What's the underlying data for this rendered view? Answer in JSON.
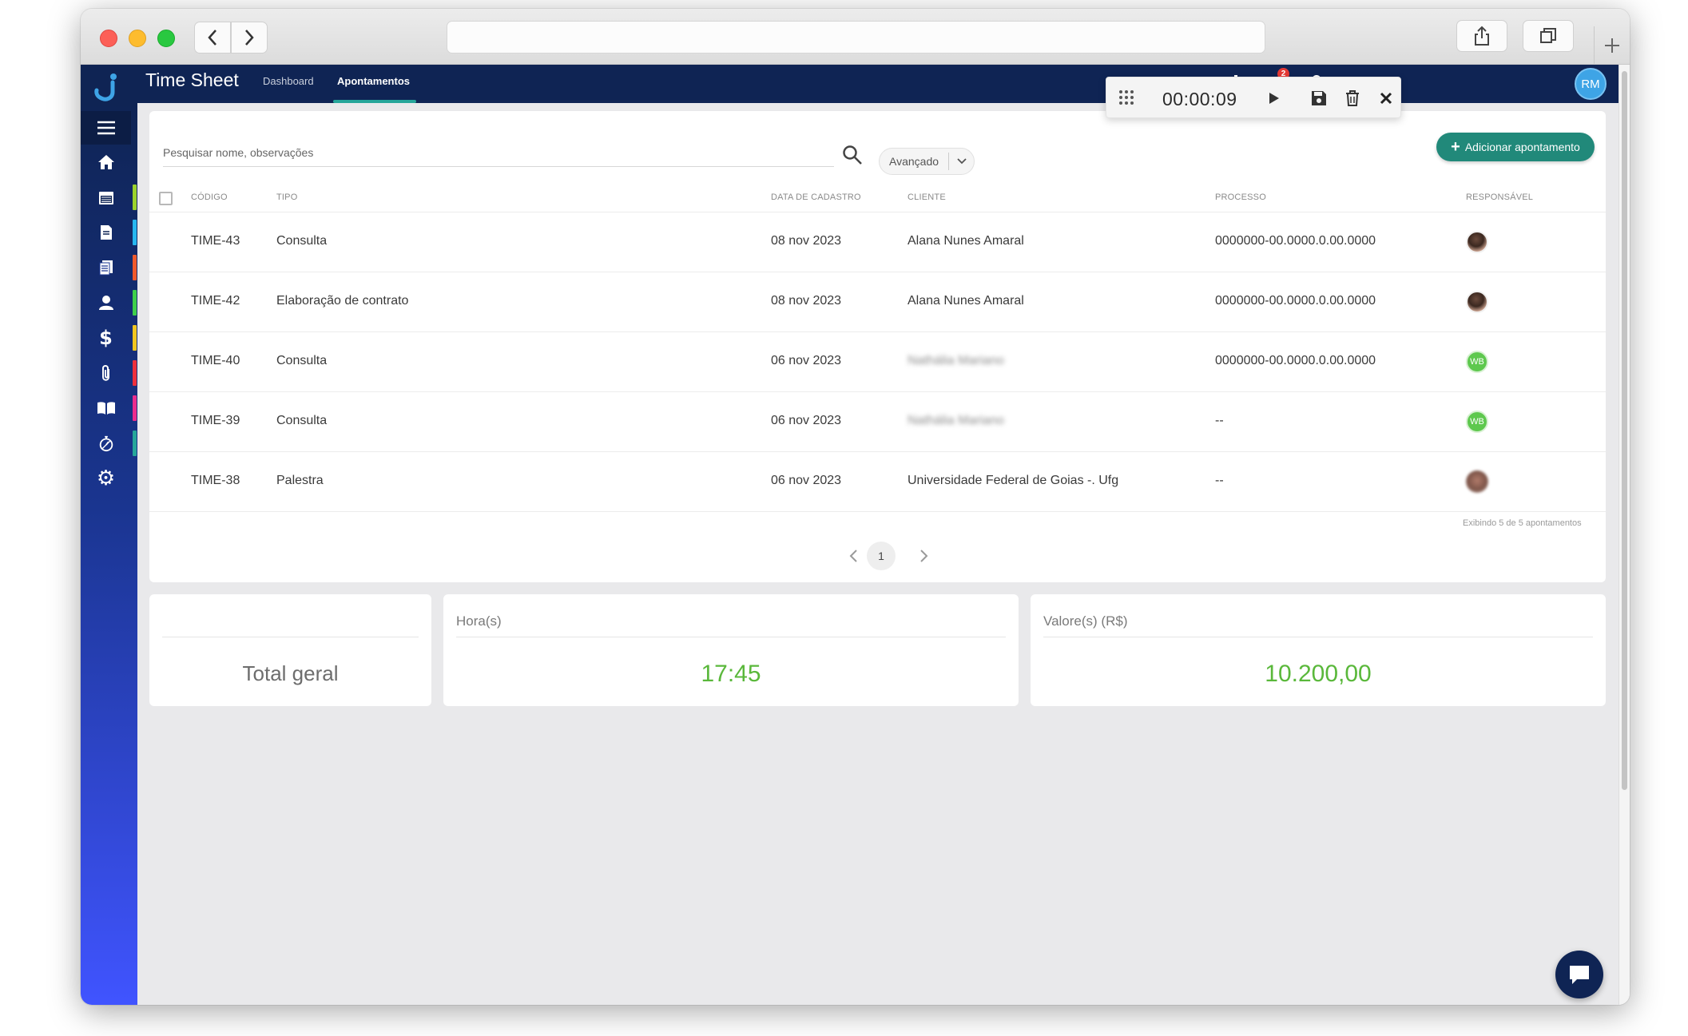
{
  "app": {
    "title": "Time Sheet",
    "nav": [
      {
        "label": "Dashboard"
      },
      {
        "label": "Apontamentos"
      }
    ],
    "notification_badge": "2",
    "user_initials": "RM"
  },
  "timer": {
    "time": "00:00:09"
  },
  "search": {
    "placeholder": "Pesquisar nome, observações",
    "advanced_label": "Avançado"
  },
  "actions": {
    "add_label": "Adicionar apontamento"
  },
  "table": {
    "columns": [
      "Código",
      "Tipo",
      "Data de cadastro",
      "Cliente",
      "Processo",
      "Responsável"
    ],
    "rows": [
      {
        "codigo": "TIME-43",
        "tipo": "Consulta",
        "data": "08 nov 2023",
        "cliente": "Alana Nunes Amaral",
        "processo": "0000000-00.0000.0.00.0000",
        "responsavel": "photo"
      },
      {
        "codigo": "TIME-42",
        "tipo": "Elaboração de contrato",
        "data": "08 nov 2023",
        "cliente": "Alana Nunes Amaral",
        "processo": "0000000-00.0000.0.00.0000",
        "responsavel": "photo"
      },
      {
        "codigo": "TIME-40",
        "tipo": "Consulta",
        "data": "06 nov 2023",
        "cliente": "Nathália Mariano",
        "processo": "0000000-00.0000.0.00.0000",
        "responsavel": "WB"
      },
      {
        "codigo": "TIME-39",
        "tipo": "Consulta",
        "data": "06 nov 2023",
        "cliente": "Nathália Mariano",
        "processo": "--",
        "responsavel": "WB"
      },
      {
        "codigo": "TIME-38",
        "tipo": "Palestra",
        "data": "06 nov 2023",
        "cliente": "Universidade Federal de Goias -. Ufg",
        "processo": "--",
        "responsavel": "photo-blurred"
      }
    ],
    "exibindo": "Exibindo 5 de 5 apontamentos"
  },
  "pagination": {
    "current_page": "1"
  },
  "summary": {
    "total_label": "Total geral",
    "hours_title": "Hora(s)",
    "hours_value": "17:45",
    "values_title": "Valore(s) (R$)",
    "values_value": "10.200,00"
  },
  "sidebar": {
    "items": [
      {
        "icon": "home-icon",
        "color": ""
      },
      {
        "icon": "calendar-icon",
        "color": "#9bd32c"
      },
      {
        "icon": "document-icon",
        "color": "#27b7f0"
      },
      {
        "icon": "documents-icon",
        "color": "#f0592b"
      },
      {
        "icon": "user-icon",
        "color": "#3ecf4a"
      },
      {
        "icon": "dollar-icon",
        "color": "#f2c61f"
      },
      {
        "icon": "paperclip-icon",
        "color": "#ee2f3c"
      },
      {
        "icon": "book-icon",
        "color": "#ec2c8c"
      },
      {
        "icon": "stopwatch-icon",
        "color": "#26a69a"
      },
      {
        "icon": "gear-icon",
        "color": ""
      }
    ]
  },
  "colors": {
    "navy": "#0f2454",
    "teal": "#21897a",
    "green_value": "#5ab83b"
  }
}
